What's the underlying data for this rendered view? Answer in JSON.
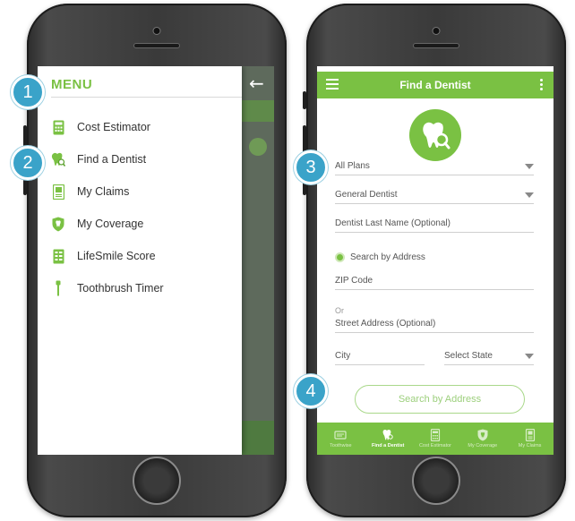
{
  "colors": {
    "brand_green": "#7ac143",
    "callout_blue": "#3aa3c9"
  },
  "left_screen": {
    "menu_title": "MENU",
    "back_icon": "arrow-left-icon",
    "items": [
      {
        "label": "Cost Estimator",
        "icon": "calculator-icon"
      },
      {
        "label": "Find a Dentist",
        "icon": "tooth-search-icon"
      },
      {
        "label": "My Claims",
        "icon": "claims-document-icon"
      },
      {
        "label": "My Coverage",
        "icon": "shield-tooth-icon"
      },
      {
        "label": "LifeSmile Score",
        "icon": "score-card-icon"
      },
      {
        "label": "Toothbrush Timer",
        "icon": "toothbrush-icon"
      }
    ]
  },
  "right_screen": {
    "header_title": "Find a Dentist",
    "plan_select": "All Plans",
    "specialty_select": "General Dentist",
    "last_name_placeholder": "Dentist Last Name (Optional)",
    "radio_label": "Search by Address",
    "zip_placeholder": "ZIP Code",
    "or_label": "Or",
    "street_placeholder": "Street Address (Optional)",
    "city_placeholder": "City",
    "state_select": "Select State",
    "search_button": "Search by Address",
    "tabs": [
      {
        "label": "Toothwise",
        "icon": "toothwise-icon",
        "active": false
      },
      {
        "label": "Find a Dentist",
        "icon": "tooth-search-icon",
        "active": true
      },
      {
        "label": "Cost Estimator",
        "icon": "calculator-icon",
        "active": false
      },
      {
        "label": "My Coverage",
        "icon": "shield-tooth-icon",
        "active": false
      },
      {
        "label": "My Claims",
        "icon": "claims-document-icon",
        "active": false
      }
    ]
  },
  "callouts": [
    "1",
    "2",
    "3",
    "4"
  ]
}
